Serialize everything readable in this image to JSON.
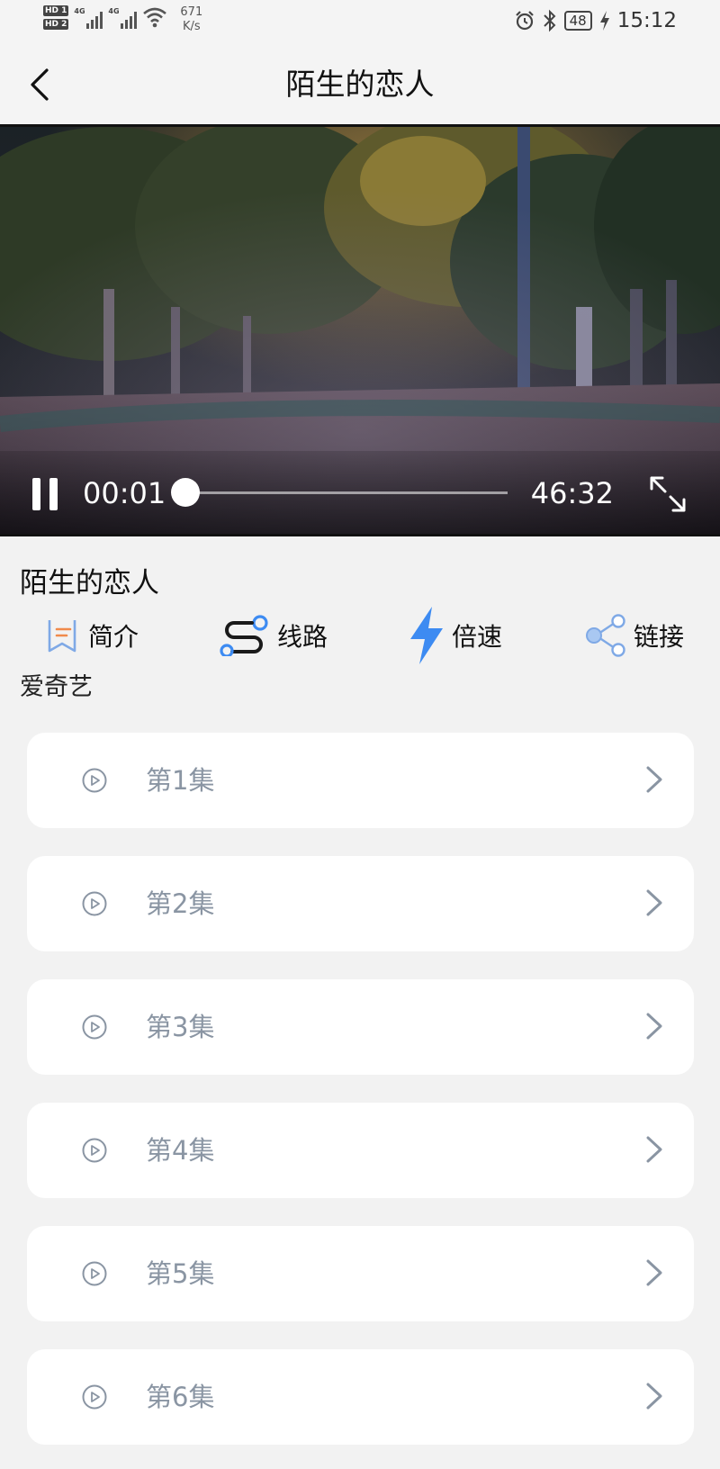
{
  "status_bar": {
    "sim1": "HD 1",
    "sim2": "HD 2",
    "net1": "4G",
    "net2": "4G",
    "speed_value": "671",
    "speed_unit": "K/s",
    "battery": "48",
    "time": "15:12"
  },
  "nav": {
    "title": "陌生的恋人"
  },
  "player": {
    "current_time": "00:01",
    "total_time": "46:32",
    "progress": 0.0004,
    "state": "playing"
  },
  "video": {
    "title": "陌生的恋人",
    "source": "爱奇艺"
  },
  "actions": [
    {
      "label": "简介",
      "icon": "bookmark-list-icon"
    },
    {
      "label": "线路",
      "icon": "route-icon"
    },
    {
      "label": "倍速",
      "icon": "lightning-icon"
    },
    {
      "label": "链接",
      "icon": "share-icon"
    }
  ],
  "episodes": [
    {
      "label": "第1集"
    },
    {
      "label": "第2集"
    },
    {
      "label": "第3集"
    },
    {
      "label": "第4集"
    },
    {
      "label": "第5集"
    },
    {
      "label": "第6集"
    }
  ],
  "colors": {
    "accent_blue": "#3d8bf2",
    "intro_orange": "#f08a4b",
    "episode_text": "#8a95a3",
    "background": "#f2f2f2"
  }
}
